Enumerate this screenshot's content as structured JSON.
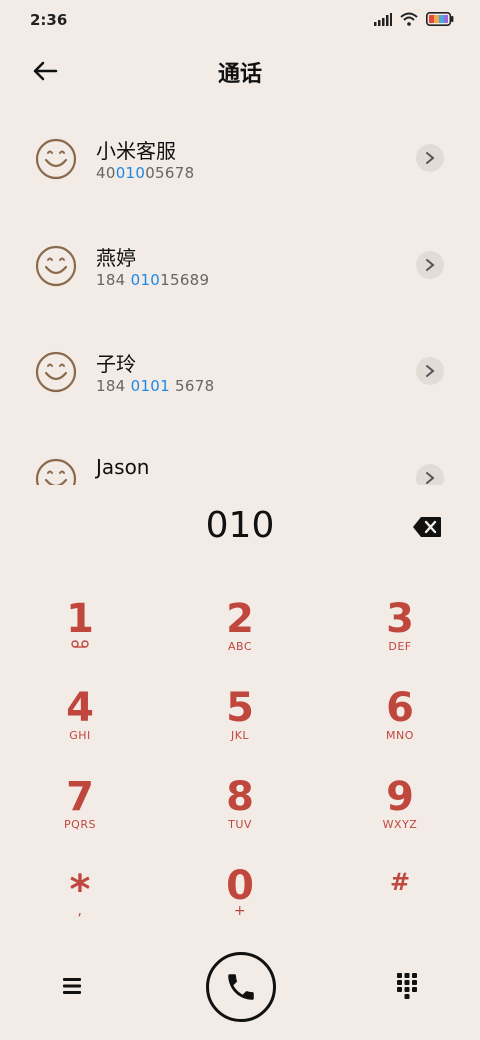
{
  "status": {
    "time": "2:36"
  },
  "header": {
    "title": "通话"
  },
  "contacts": [
    {
      "name": "小米客服",
      "number_pre": "40",
      "number_hl": "010",
      "number_post": "05678"
    },
    {
      "name": "燕婷",
      "number_pre": "184 ",
      "number_hl": "010",
      "number_post": "15689"
    },
    {
      "name": "子玲",
      "number_pre": "184 ",
      "number_hl": "0101",
      "number_post": " 5678"
    },
    {
      "name": "Jason",
      "number_pre": "",
      "number_hl": "",
      "number_post": ""
    }
  ],
  "dialer": {
    "entry": "010"
  },
  "keys": [
    {
      "digit": "1",
      "letters": ""
    },
    {
      "digit": "2",
      "letters": "ABC"
    },
    {
      "digit": "3",
      "letters": "DEF"
    },
    {
      "digit": "4",
      "letters": "GHI"
    },
    {
      "digit": "5",
      "letters": "JKL"
    },
    {
      "digit": "6",
      "letters": "MNO"
    },
    {
      "digit": "7",
      "letters": "PQRS"
    },
    {
      "digit": "8",
      "letters": "TUV"
    },
    {
      "digit": "9",
      "letters": "WXYZ"
    },
    {
      "digit": "*",
      "letters": ","
    },
    {
      "digit": "0",
      "letters": "+"
    },
    {
      "digit": "#",
      "letters": ""
    }
  ],
  "colors": {
    "accent": "#c0473e",
    "highlight": "#1e88e5",
    "background": "#f2ebe6",
    "avatar": "#8b6a4c"
  },
  "icons": {
    "back": "arrow-left-icon",
    "avatar": "smiley-icon",
    "chevron": "chevron-right-icon",
    "backspace": "backspace-icon",
    "voicemail": "voicemail-icon",
    "menu": "menu-icon",
    "call": "phone-icon",
    "dialpad": "dialpad-icon"
  }
}
